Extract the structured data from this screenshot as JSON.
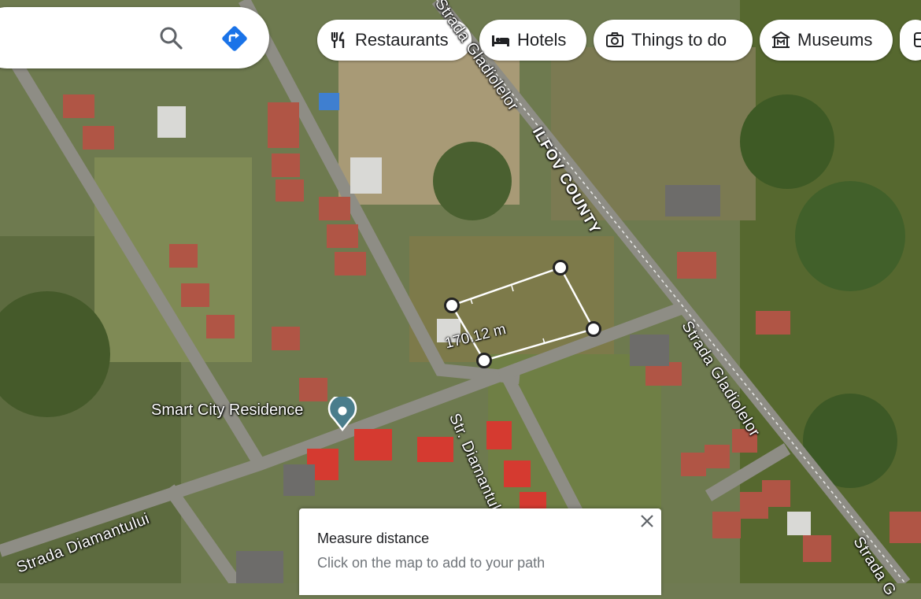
{
  "search": {
    "search_icon": "search-icon",
    "directions_icon": "directions-icon",
    "directions_color": "#1a73e8"
  },
  "chips": [
    {
      "label": "Restaurants",
      "icon": "fork-knife-icon"
    },
    {
      "label": "Hotels",
      "icon": "bed-icon"
    },
    {
      "label": "Things to do",
      "icon": "camera-icon"
    },
    {
      "label": "Museums",
      "icon": "museum-icon"
    }
  ],
  "map_labels": {
    "strada_gladiolelor_top": "Strada Gladiolelor",
    "ilfov_county": "ILFOV COUNTY",
    "strada_gladiolelor_right": "Strada Gladiolelor",
    "str_diamantului": "Str. Diamantului",
    "strada_diamantului": "Strada Diamantului",
    "strada_right_bottom": "Strada G"
  },
  "place": {
    "name": "Smart City Residence"
  },
  "measurement": {
    "distance": "170.12 m"
  },
  "measure_panel": {
    "title": "Measure distance",
    "hint": "Click on the map to add to your path",
    "close_icon": "close-icon"
  }
}
